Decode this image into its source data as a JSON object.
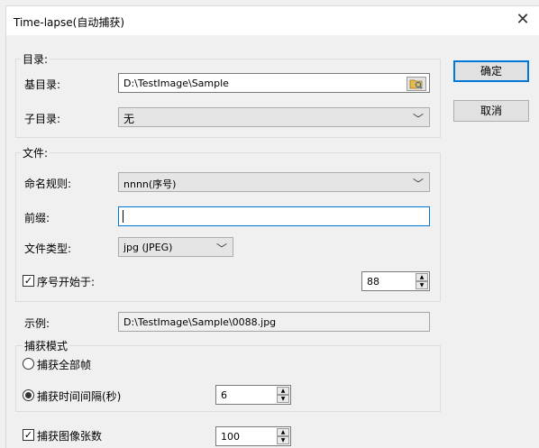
{
  "window": {
    "title": "Time-lapse(自动捕获)"
  },
  "buttons": {
    "ok": "确定",
    "cancel": "取消"
  },
  "directory": {
    "group_title": "目录:",
    "base_label": "基目录:",
    "base_value": "D:\\TestImage\\Sample",
    "sub_label": "子目录:",
    "sub_value": "无"
  },
  "file": {
    "group_title": "文件:",
    "naming_label": "命名规则:",
    "naming_value": "nnnn(序号)",
    "prefix_label": "前缀:",
    "prefix_value": "",
    "type_label": "文件类型:",
    "type_value": "jpg (JPEG)",
    "seq_start_label": "序号开始于:",
    "seq_start_checked": true,
    "seq_start_value": "88"
  },
  "example": {
    "label": "示例:",
    "value": "D:\\TestImage\\Sample\\0088.jpg"
  },
  "capture_mode": {
    "group_title": "捕获模式",
    "all_frames_label": "捕获全部帧",
    "all_frames_selected": false,
    "interval_label": "捕获时间间隔(秒)",
    "interval_selected": true,
    "interval_value": "6"
  },
  "capture_count": {
    "label": "捕获图像张数",
    "checked": true,
    "value": "100"
  },
  "icons": {
    "close": "close-icon",
    "folder": "folder-browse-icon",
    "dropdown": "chevron-down-icon"
  }
}
